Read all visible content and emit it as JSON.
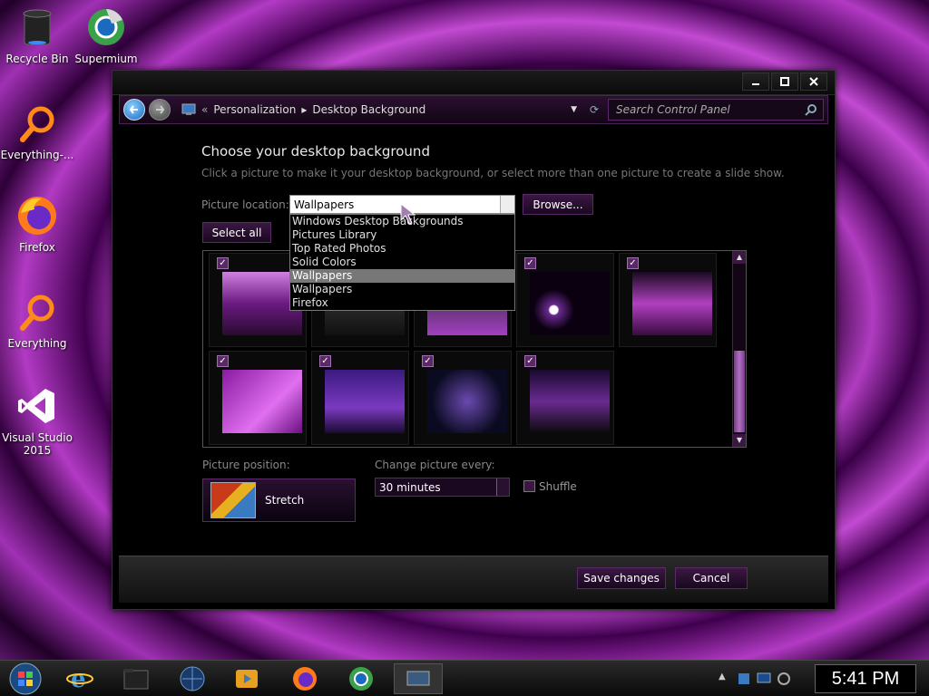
{
  "desktop_icons": [
    {
      "label": "Recycle Bin",
      "icon": "recycle-bin-icon"
    },
    {
      "label": "Supermium",
      "icon": "supermium-icon"
    },
    {
      "label": "Everything-...",
      "icon": "everything-search-icon"
    },
    {
      "label": "Firefox",
      "icon": "firefox-icon"
    },
    {
      "label": "Everything",
      "icon": "everything-search-icon"
    },
    {
      "label": "Visual Studio 2015",
      "icon": "visual-studio-icon"
    }
  ],
  "window": {
    "breadcrumb": [
      "Personalization",
      "Desktop Background"
    ],
    "search_placeholder": "Search Control Panel",
    "heading": "Choose your desktop background",
    "subheading": "Click a picture to make it your desktop background, or select more than one picture to create a slide show.",
    "picture_location_label": "Picture location:",
    "picture_location_value": "Wallpapers",
    "browse_label": "Browse...",
    "select_all_label": "Select all",
    "dropdown_options": [
      "Windows Desktop Backgrounds",
      "Pictures Library",
      "Top Rated Photos",
      "Solid Colors",
      "Wallpapers",
      "Wallpapers",
      "Firefox"
    ],
    "dropdown_selected_index": 4,
    "picture_position_label": "Picture position:",
    "picture_position_value": "Stretch",
    "change_every_label": "Change picture every:",
    "change_every_value": "30 minutes",
    "shuffle_label": "Shuffle",
    "save_label": "Save changes",
    "cancel_label": "Cancel"
  },
  "taskbar": {
    "clock": "5:41 PM",
    "pinned": [
      "start-orb-icon",
      "internet-explorer-icon",
      "folder-icon",
      "globe-icon",
      "media-player-icon",
      "firefox-icon",
      "supermium-icon",
      "control-panel-icon"
    ]
  },
  "colors": {
    "accent": "#5a2a66",
    "window_bg": "#000000",
    "selected_option": "#777777"
  }
}
